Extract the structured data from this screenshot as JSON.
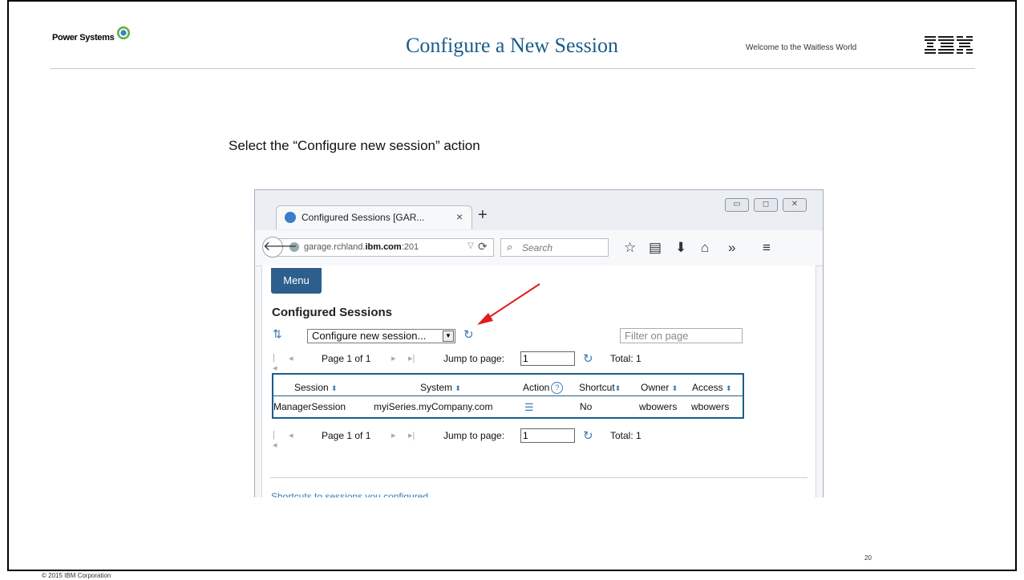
{
  "slide": {
    "brand": "Power Systems",
    "title": "Configure a New Session",
    "welcome": "Welcome to the Waitless World",
    "ibm": "IBM",
    "subtitle": "Select the “Configure new session” action",
    "copyright": "© 2015 IBM Corporation",
    "page_number": "20"
  },
  "browser": {
    "tab_title": "Configured Sessions [GAR...",
    "tab_close": "×",
    "new_tab": "+",
    "url_prefix": "garage.rchland.",
    "url_host": "ibm.com",
    "url_suffix": ":201",
    "search_placeholder": "Search"
  },
  "page": {
    "menu_label": "Menu",
    "heading": "Configured Sessions",
    "action_select_value": "Configure new session...",
    "filter_placeholder": "Filter on page",
    "pager": {
      "page_text": "Page 1 of 1",
      "jump_label": "Jump to page:",
      "jump_value": "1",
      "total": "Total: 1"
    },
    "table": {
      "headers": [
        "Session",
        "System",
        "Action",
        "Shortcut",
        "Owner",
        "Access"
      ],
      "rows": [
        [
          "ManagerSession",
          "myiSeries.myCompany.com",
          "",
          "No",
          "wbowers",
          "wbowers"
        ]
      ]
    },
    "shortcuts_link": "Shortcuts to sessions you configured"
  },
  "colors": {
    "title": "#1a5e8a",
    "menu": "#2c5f8c",
    "arrow": "#e21b1b"
  }
}
